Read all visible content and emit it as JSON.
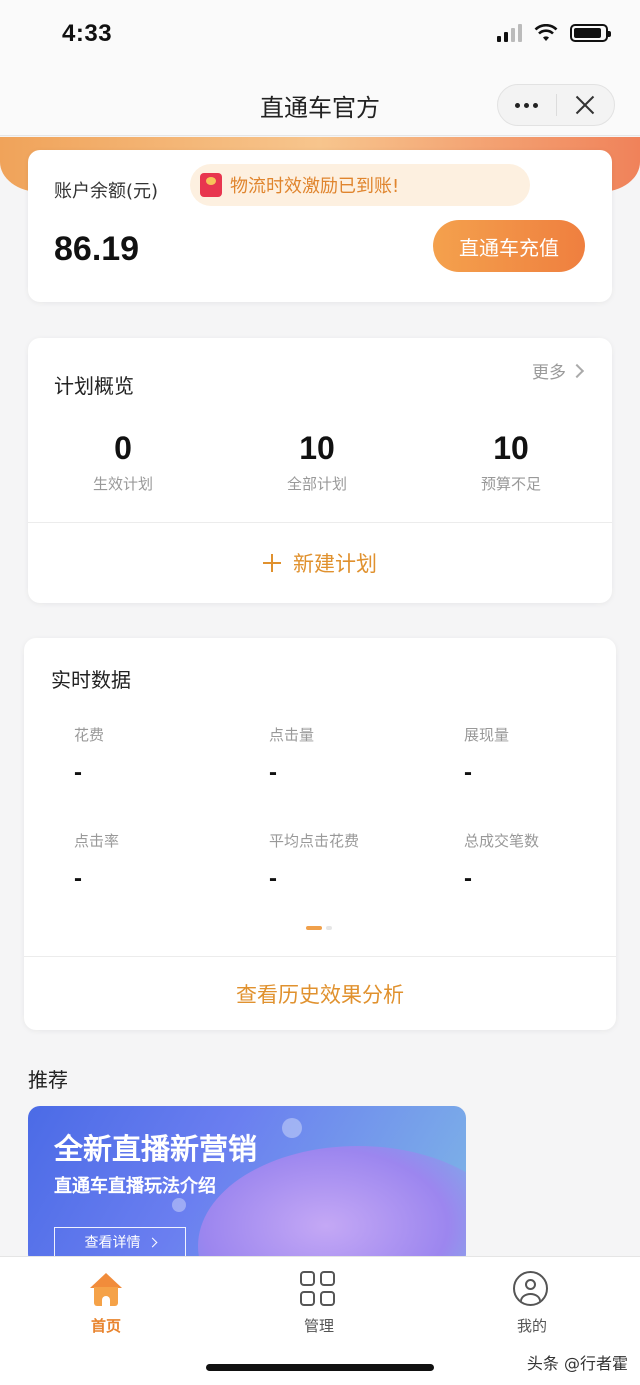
{
  "status_bar": {
    "time": "4:33"
  },
  "nav": {
    "title": "直通车官方"
  },
  "balance": {
    "label": "账户余额(元)",
    "notice": "物流时效激励已到账!",
    "value": "86.19",
    "recharge_label": "直通车充值"
  },
  "plan": {
    "title": "计划概览",
    "more": "更多",
    "stats": [
      {
        "value": "0",
        "label": "生效计划"
      },
      {
        "value": "10",
        "label": "全部计划"
      },
      {
        "value": "10",
        "label": "预算不足"
      }
    ],
    "new_plan_label": "新建计划"
  },
  "realtime": {
    "title": "实时数据",
    "metrics": [
      {
        "label": "花费",
        "value": "-"
      },
      {
        "label": "点击量",
        "value": "-"
      },
      {
        "label": "展现量",
        "value": "-"
      },
      {
        "label": "点击率",
        "value": "-"
      },
      {
        "label": "平均点击花费",
        "value": "-"
      },
      {
        "label": "总成交笔数",
        "value": "-"
      }
    ],
    "history_link": "查看历史效果分析"
  },
  "recommend": {
    "title": "推荐",
    "banner_headline": "全新直播新营销",
    "banner_sub": "直通车直播玩法介绍",
    "banner_button": "查看详情"
  },
  "tabs": [
    {
      "label": "首页",
      "icon": "home-icon",
      "active": true
    },
    {
      "label": "管理",
      "icon": "grid-icon",
      "active": false
    },
    {
      "label": "我的",
      "icon": "user-icon",
      "active": false
    }
  ],
  "watermark": "头条 @行者霍",
  "colors": {
    "accent": "#e8842e",
    "button_start": "#f4a14d",
    "button_end": "#ef7f3f"
  }
}
